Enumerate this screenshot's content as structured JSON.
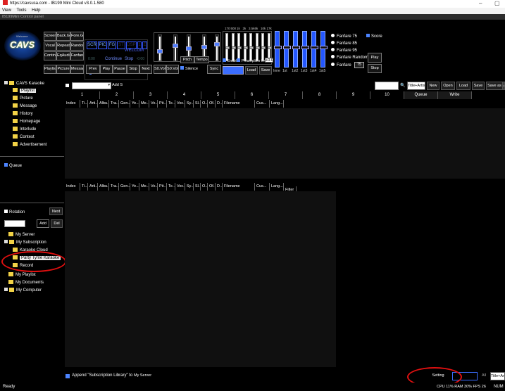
{
  "window": {
    "title": "https://cavsusa.com - IB199 Mini Cloud v3.0.1.580",
    "minimize": "–",
    "restore": "▢"
  },
  "menu": [
    "View",
    "Tools",
    "Help"
  ],
  "control_panel_label": "IB199Mini Control panel",
  "logo": {
    "text": "CAVS",
    "small": "Welcome"
  },
  "left_buttons": [
    [
      "Screen",
      "Back.G",
      "Fore.G"
    ],
    [
      "Vocal",
      "Repeat",
      "Random"
    ],
    [
      "Continue",
      "EqAudio",
      "Fanfare"
    ],
    [
      "Playlist",
      "Picture",
      "Message"
    ]
  ],
  "segments": [
    "SCR",
    "PIC",
    "FG",
    "ST",
    "DSP",
    "1",
    "E"
  ],
  "player": {
    "welcome": "WELCOM",
    "continue": "Continue",
    "stop": "Stop",
    "time_left": "0:00",
    "time_right": "-0:00",
    "progress": 0.02
  },
  "transport": [
    "Prev",
    "Play",
    "Pause",
    "Stop",
    "Next",
    "S0.Vol",
    "S0.Vol"
  ],
  "silence_label": "Silence",
  "sync_label": "Sync",
  "pitch_label": "Pitch",
  "tempo_label": "Tempo",
  "eq": {
    "freqs": [
      "170",
      "500",
      "1k",
      "2k",
      "3.5k",
      "6k",
      "10k",
      "17k"
    ],
    "enable": "Enable",
    "preamp": "Preamplifier lev.",
    "preamp_value": "+0.0",
    "load": "Load",
    "save": "Save"
  },
  "bands": [
    "Inne",
    "1st",
    "1st2",
    "1st3",
    "1st4",
    "1st5"
  ],
  "fanfare": {
    "options": [
      "Fanfare 75",
      "Fanfare 85",
      "Fanfare 95",
      "Fanfare Random",
      "Fanfare"
    ],
    "value": "75",
    "score": "Score",
    "play": "Play",
    "stop": "Stop"
  },
  "tree": {
    "root": "CAVS Karaoke",
    "items": [
      "Playlist",
      "Picture",
      "Message",
      "History",
      "Homepage",
      "Interlude",
      "Contest",
      "Advertisement"
    ],
    "queue": "Queue"
  },
  "rotation": {
    "label": "Rotation",
    "next": "Next",
    "add": "Add",
    "del": "Del"
  },
  "library": {
    "items": [
      "My Server",
      "My Subscription",
      "Karaoke Cloud",
      "Party Tyme Karaoke",
      "Record",
      "My Playlist",
      "My Documents",
      "My Computer"
    ]
  },
  "toolbar": {
    "add_sel": "Add Sel",
    "sort": "Title+Artist",
    "buttons": [
      "New",
      "Open",
      "Load",
      "Save",
      "Save as",
      "App"
    ]
  },
  "tabs": [
    "1",
    "2",
    "3",
    "4",
    "5",
    "6",
    "7",
    "8",
    "9",
    "10",
    "Queue",
    "Write"
  ],
  "columns": [
    "Index",
    "Ti...",
    "Arti...",
    "Albu...",
    "Tra...",
    "Gen...",
    "Ye...",
    "Me...",
    "Vo...",
    "Pit...",
    "Te...",
    "Voc...",
    "Sy...",
    "Sl...",
    "O...",
    "Of...",
    "D...",
    "Filename",
    "Cus...",
    "Lang..."
  ],
  "filter_label": "Filter",
  "append_text": "Append \"Subscription Library\" to",
  "append_target": "My Server",
  "setting_label": "Setting",
  "all_label": "All",
  "status": {
    "ready": "Ready",
    "cpu": "CPU 11% RAM 30% FPS 26",
    "num": "NUM"
  }
}
